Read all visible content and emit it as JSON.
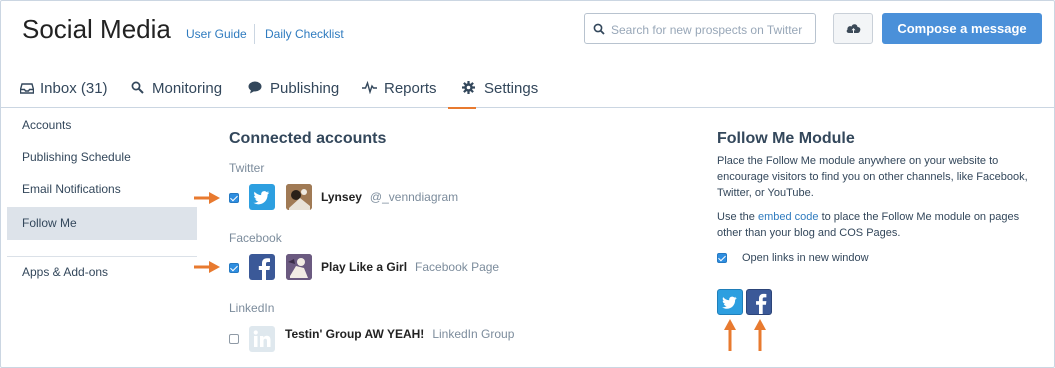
{
  "header": {
    "title": "Social Media",
    "user_guide": "User Guide",
    "daily_checklist": "Daily Checklist",
    "search_placeholder": "Search for new prospects on Twitter",
    "compose_label": "Compose a message"
  },
  "tabs": [
    {
      "label": "Inbox (31)",
      "icon": "inbox-icon"
    },
    {
      "label": "Monitoring",
      "icon": "search-icon"
    },
    {
      "label": "Publishing",
      "icon": "speech-bubble-icon"
    },
    {
      "label": "Reports",
      "icon": "pulse-icon"
    },
    {
      "label": "Settings",
      "icon": "gear-icon",
      "active": true
    }
  ],
  "sidebar": {
    "items": [
      {
        "label": "Accounts"
      },
      {
        "label": "Publishing Schedule"
      },
      {
        "label": "Email Notifications"
      },
      {
        "label": "Follow Me",
        "active": true
      },
      {
        "label": "Apps & Add-ons"
      }
    ]
  },
  "connected": {
    "heading": "Connected accounts",
    "groups": [
      {
        "name": "Twitter",
        "account": "Lynsey",
        "detail": "@_venndiagram",
        "checked": true
      },
      {
        "name": "Facebook",
        "account": "Play Like a Girl",
        "detail": "Facebook Page",
        "checked": true
      },
      {
        "name": "LinkedIn",
        "account": "Testin' Group AW YEAH!",
        "detail": "LinkedIn Group",
        "checked": false
      }
    ]
  },
  "follow_me": {
    "heading": "Follow Me Module",
    "description": "Place the Follow Me module anywhere on your website to encourage visitors to find you on other channels, like Facebook, Twitter, or YouTube.",
    "embed_prefix": "Use the ",
    "embed_link": "embed code",
    "embed_suffix": " to place the Follow Me module on pages other than your blog and COS Pages.",
    "open_links_label": "Open links in new window",
    "open_links_checked": true
  },
  "colors": {
    "accent": "#e87a2f",
    "primary_button": "#4a90d9",
    "twitter": "#2d9fe0",
    "facebook": "#3b5998",
    "link": "#2f7bbf"
  }
}
